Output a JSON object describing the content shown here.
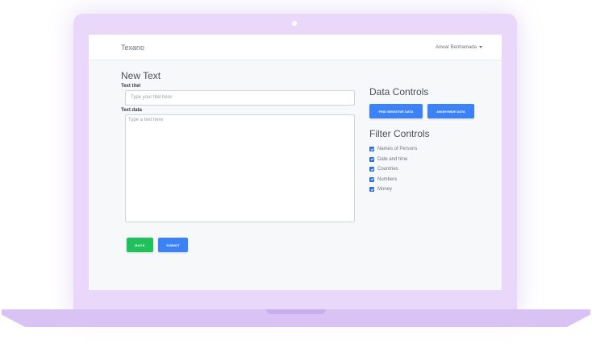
{
  "nav": {
    "brand": "Texano",
    "user_name": "Anwar Benhamada"
  },
  "form": {
    "title": "New Text",
    "title_label": "Text titel",
    "title_placeholder": "Type your titel here",
    "data_label": "Text data",
    "data_placeholder": "Type a text here",
    "back_label": "BACK",
    "submit_label": "SUBMIT"
  },
  "data_controls": {
    "title": "Data Controls",
    "find_label": "FIND SENSITIVE DATA",
    "anonymize_label": "ANONYMIZE DATA"
  },
  "filter_controls": {
    "title": "Filter Controls",
    "items": [
      {
        "label": "Names of Persons",
        "checked": true
      },
      {
        "label": "Date and time",
        "checked": true
      },
      {
        "label": "Countries",
        "checked": true
      },
      {
        "label": "Numbers",
        "checked": true
      },
      {
        "label": "Money",
        "checked": true
      }
    ]
  },
  "colors": {
    "primary": "#3b82f6",
    "success": "#20c05a",
    "checkbox": "#2f6fd6",
    "laptop": "#ead8fb"
  }
}
